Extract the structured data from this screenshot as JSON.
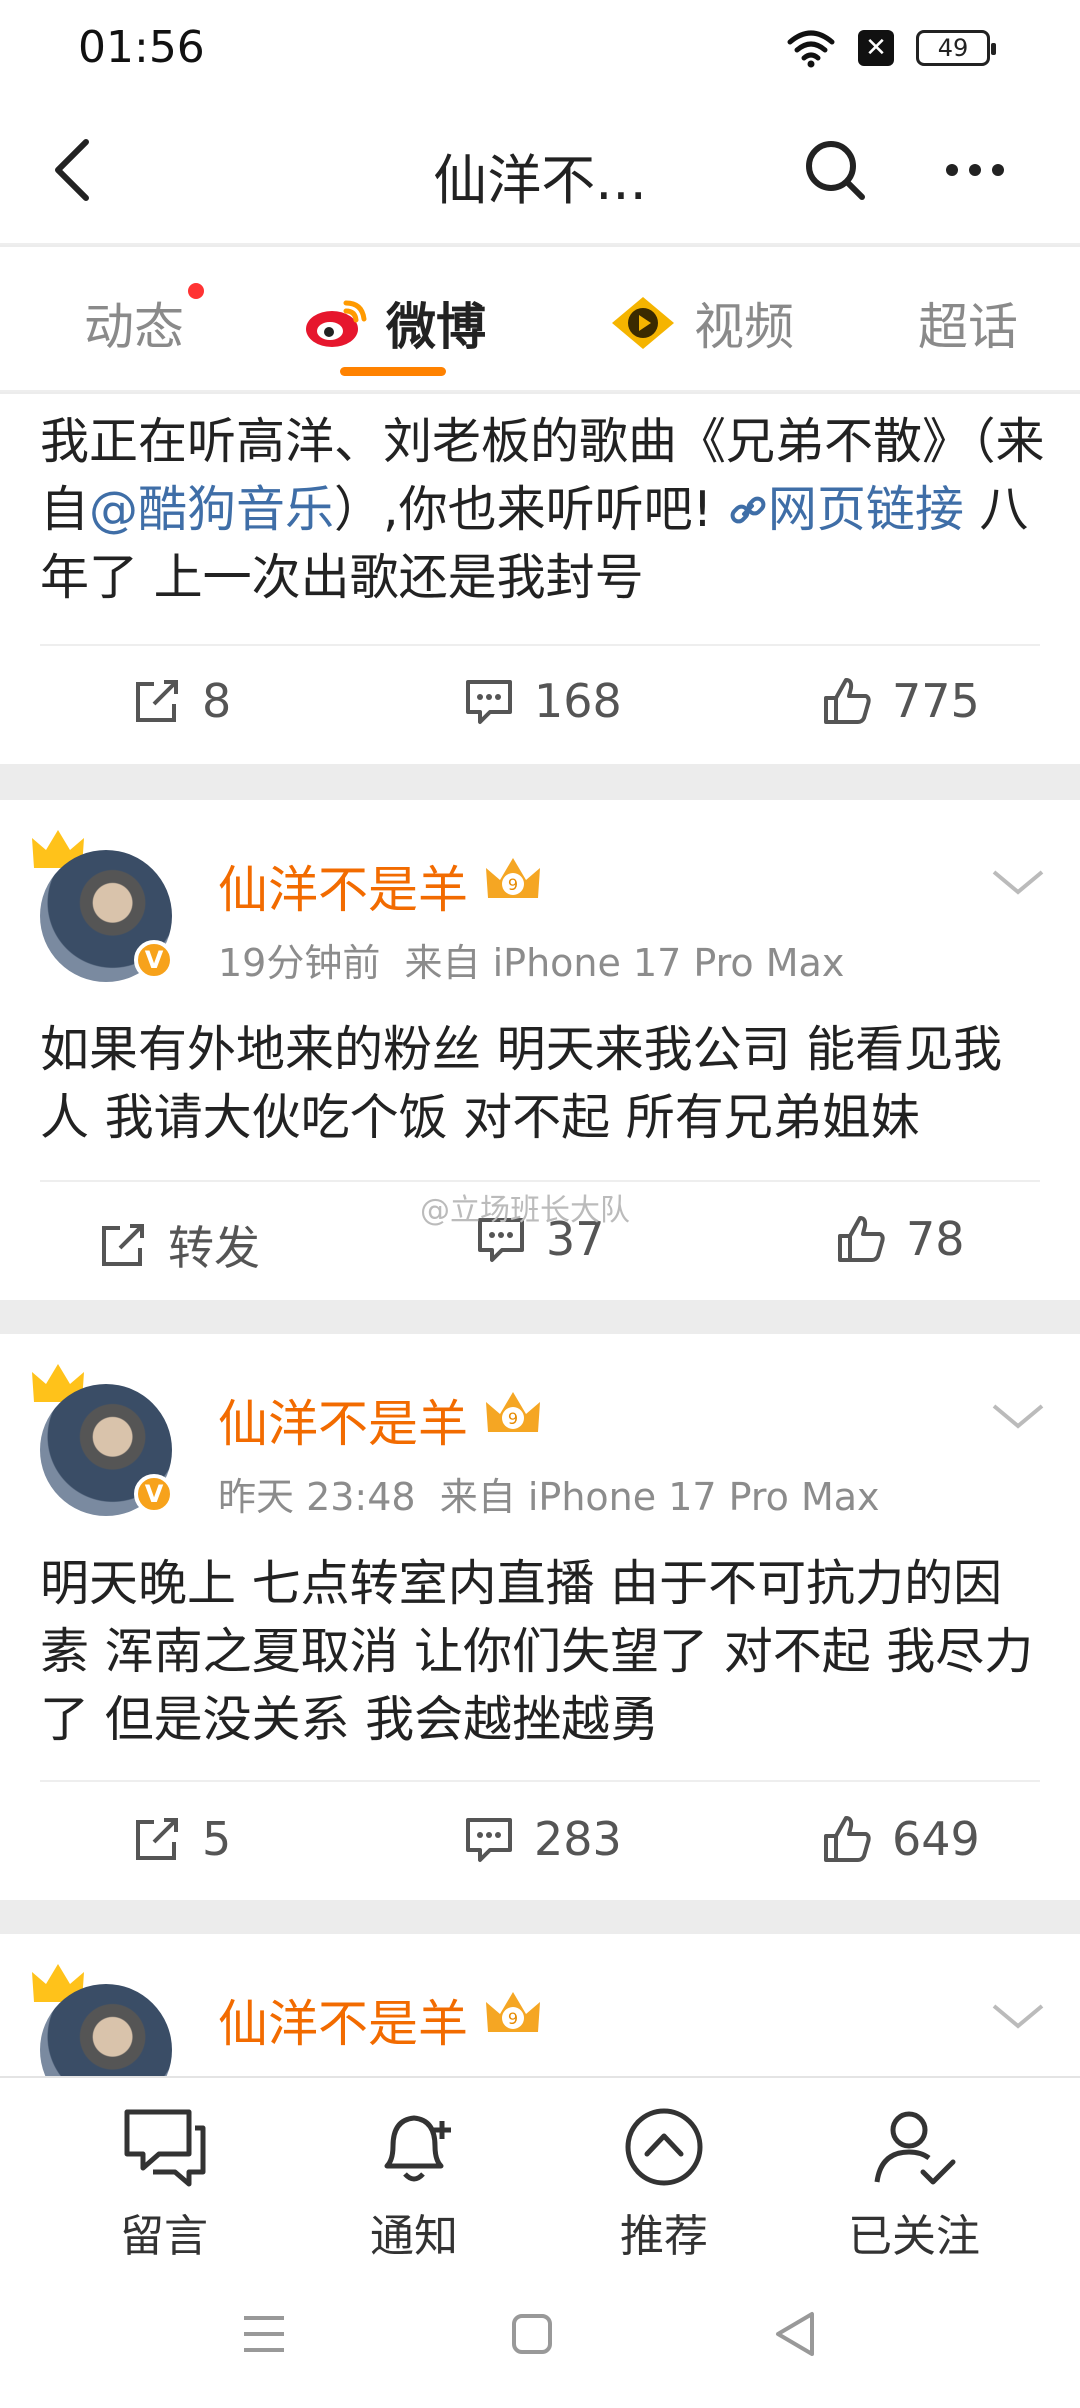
{
  "status": {
    "time": "01:56",
    "battery": "49"
  },
  "header": {
    "title": "仙洋不..."
  },
  "tabs": [
    {
      "label": "动态"
    },
    {
      "label": "微博"
    },
    {
      "label": "视频"
    },
    {
      "label": "超话"
    }
  ],
  "post0": {
    "text_a": "我正在听高洋、刘老板的歌曲《兄弟不散》（来自",
    "mention": "@酷狗音乐",
    "text_b": "）,你也来听听吧! ",
    "link_label": "网页链接",
    "text_c": "  八年了 上一次出歌还是我封号",
    "repost": "8",
    "comments": "168",
    "likes": "775"
  },
  "post1": {
    "username": "仙洋不是羊",
    "time": "19分钟前",
    "source": "来自 iPhone 17 Pro Max",
    "text": "如果有外地来的粉丝 明天来我公司 能看见我人 我请大伙吃个饭 对不起 所有兄弟姐妹",
    "repost": "转发",
    "comments": "37",
    "likes": "78"
  },
  "watermark": "@立场班长大队",
  "post2": {
    "username": "仙洋不是羊",
    "time": "昨天 23:48",
    "source": "来自 iPhone 17 Pro Max",
    "text": "明天晚上 七点转室内直播 由于不可抗力的因素 浑南之夏取消 让你们失望了 对不起 我尽力了 但是没关系 我会越挫越勇",
    "repost": "5",
    "comments": "283",
    "likes": "649"
  },
  "post3": {
    "username": "仙洋不是羊"
  },
  "bottom_nav": [
    {
      "label": "留言"
    },
    {
      "label": "通知"
    },
    {
      "label": "推荐"
    },
    {
      "label": "已关注"
    }
  ],
  "vip_level": "9",
  "colors": {
    "accent": "#ff8200",
    "username": "#f26b00",
    "link": "#3f6ea7",
    "badge": "#f7a21b"
  }
}
